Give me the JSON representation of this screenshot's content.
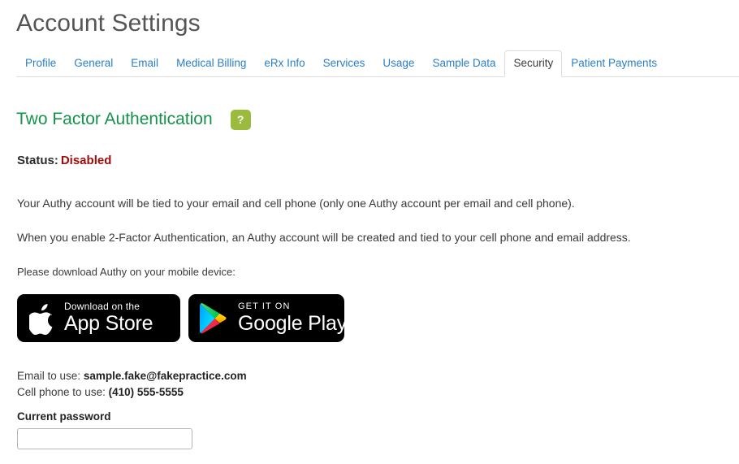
{
  "header": {
    "title": "Account Settings"
  },
  "tabs": {
    "items": [
      {
        "label": "Profile",
        "active": false
      },
      {
        "label": "General",
        "active": false
      },
      {
        "label": "Email",
        "active": false
      },
      {
        "label": "Medical Billing",
        "active": false
      },
      {
        "label": "eRx Info",
        "active": false
      },
      {
        "label": "Services",
        "active": false
      },
      {
        "label": "Usage",
        "active": false
      },
      {
        "label": "Sample Data",
        "active": false
      },
      {
        "label": "Security",
        "active": true
      },
      {
        "label": "Patient Payments",
        "active": false
      }
    ]
  },
  "section": {
    "title": "Two Factor Authentication",
    "help_label": "?",
    "help_icon": "question-mark-icon",
    "status_label": "Status:",
    "status_value": "Disabled"
  },
  "body": {
    "paragraph_1": "Your Authy account will be tied to your email and cell phone (only one Authy account per email and cell phone).",
    "paragraph_2": "When you enable 2-Factor Authentication, an Authy account will be created and tied to your cell phone and email address.",
    "paragraph_3": "Please download Authy on your mobile device:"
  },
  "badges": {
    "app_store": {
      "icon": "apple-logo-icon",
      "small_text": "Download on the",
      "big_text": "App Store"
    },
    "google_play": {
      "icon": "google-play-triangle-icon",
      "small_text": "GET IT ON",
      "big_text": "Google Play"
    }
  },
  "account": {
    "email_label": "Email to use:",
    "email_value": "sample.fake@fakepractice.com",
    "cell_label": "Cell phone to use:",
    "cell_value": "(410) 555-5555"
  },
  "password": {
    "label": "Current password",
    "value": "",
    "placeholder": ""
  },
  "colors": {
    "tab_link": "#2a7fc9",
    "section_green": "#15924b",
    "help_green": "#9bbb3f",
    "status_red": "#a00c0c",
    "badge_black": "#000000",
    "gplay_blue": "#00c3ff",
    "gplay_green": "#00e676",
    "gplay_yellow": "#ffd600",
    "gplay_red": "#ff3a44"
  }
}
